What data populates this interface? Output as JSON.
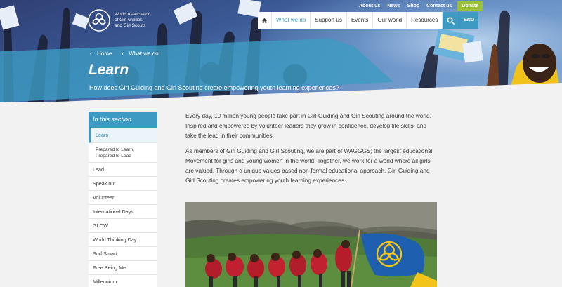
{
  "logo": {
    "line1": "World Association",
    "line2": "of Girl Guides",
    "line3": "and Girl Scouts"
  },
  "util_nav": {
    "about": "About us",
    "news": "News",
    "shop": "Shop",
    "contact": "Contact us",
    "donate": "Donate"
  },
  "main_nav": {
    "home_icon": "home-icon",
    "items": [
      "What we do",
      "Support us",
      "Events",
      "Our world",
      "Resources"
    ],
    "search_icon": "search-icon",
    "lang": "ENG"
  },
  "breadcrumb": {
    "home": "Home",
    "current": "What we do"
  },
  "page": {
    "title": "Learn",
    "subtitle": "How does Girl Guiding and Girl Scouting create empowering youth learning experiences?"
  },
  "sidebar": {
    "heading": "In this section",
    "items": [
      "Learn",
      "Prepared to Learn, Prepared to Lead",
      "Lead",
      "Speak out",
      "Volunteer",
      "International Days",
      "GLOW",
      "World Thinking Day",
      "Surf Smart",
      "Free Being Me",
      "Millennium"
    ]
  },
  "content": {
    "p1": "Every day, 10 million young people take part in Girl Guiding and Girl Scouting around the world. Inspired and empowered by volunteer leaders they grow in confidence, develop life skills, and take the lead in their communities.",
    "p2": "As members of Girl Guiding and Girl Scouting, we are part of WAGGGS; the largest educational Movement for girls and young women in the world. Together, we work for a world where all girls are valued. Through a unique values based non-formal educational approach, Girl Guiding and Girl Scouting creates empowering youth learning experiences."
  },
  "colors": {
    "brand_teal": "#3d9ac2",
    "donate_green": "#9bc03a",
    "flag_blue": "#1f5fb0"
  }
}
